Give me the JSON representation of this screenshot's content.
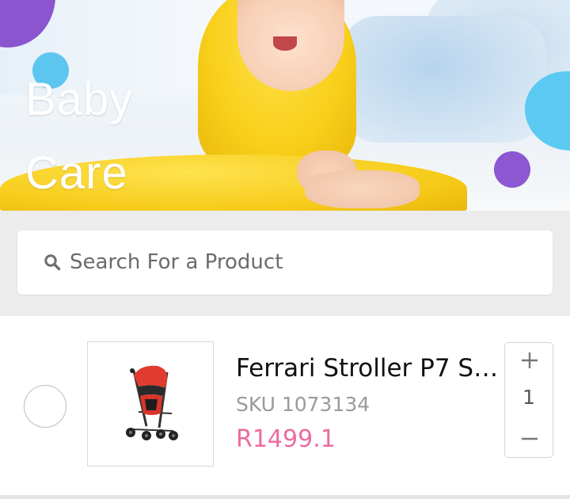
{
  "banner": {
    "title_line1": "Baby",
    "title_line2": "Care",
    "colors": {
      "purple": "#8a55cf",
      "blue": "#5dc6f0"
    }
  },
  "search": {
    "placeholder": "Search For a Product",
    "icon": "search-icon"
  },
  "product": {
    "name": "Ferrari Stroller P7 Su...",
    "sku": "SKU 1073134",
    "price": "R1499.1",
    "price_color": "#ec6ba1",
    "quantity": "1",
    "image_icon": "stroller-icon"
  },
  "stepper": {
    "increment_icon": "plus-icon",
    "decrement_icon": "minus-icon"
  }
}
